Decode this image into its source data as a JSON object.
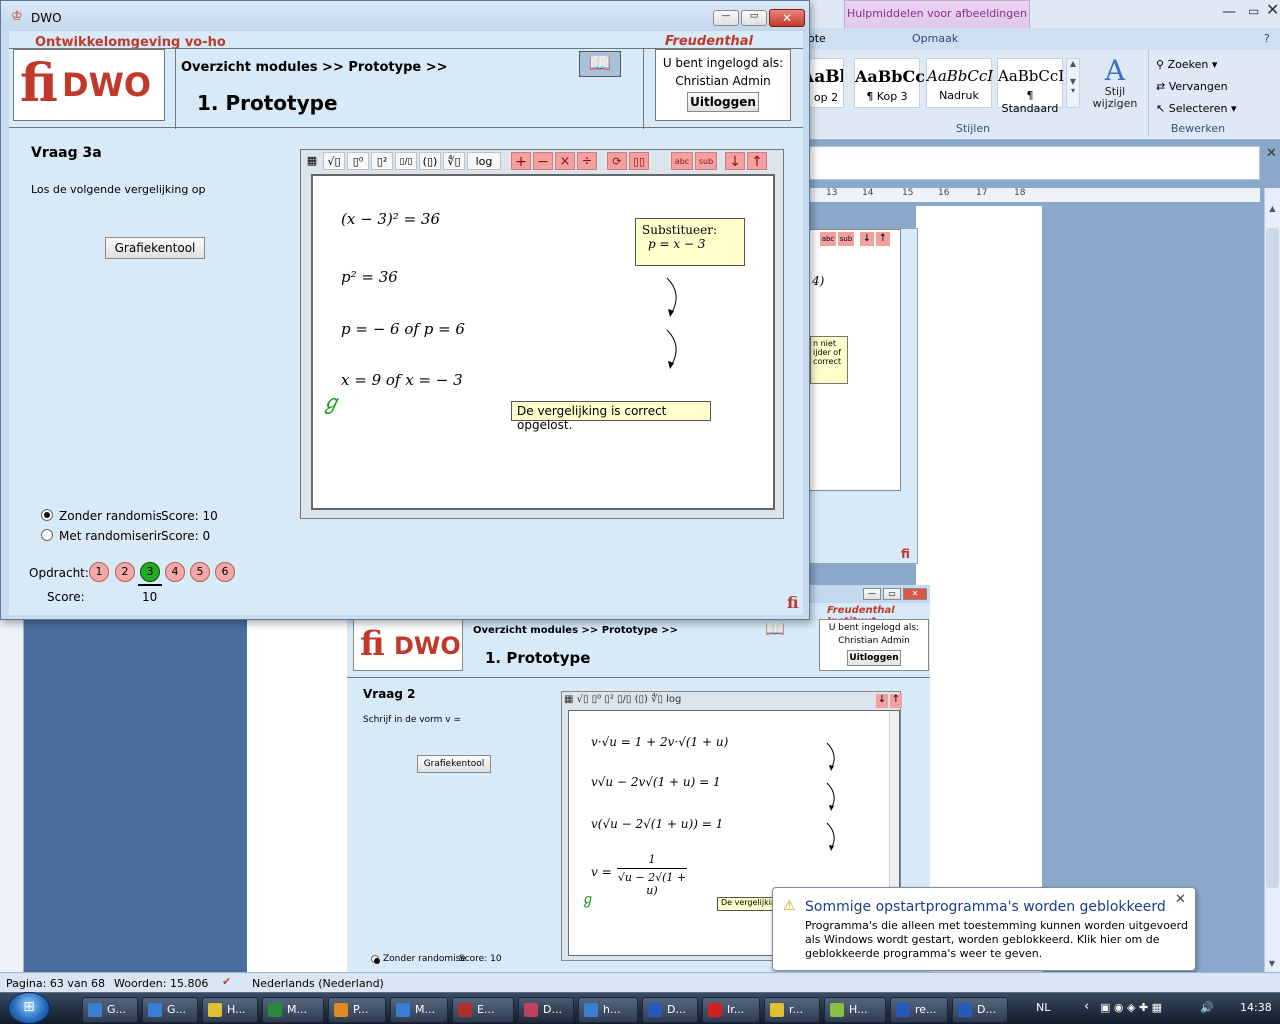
{
  "word": {
    "context_tab": "Hulpmiddelen voor afbeeldingen",
    "tab_cut": "ote",
    "tab_opmaak": "Opmaak",
    "styles": [
      {
        "sample": "AaBbC",
        "name": "op 2"
      },
      {
        "sample": "AaBbCc",
        "name": "¶ Kop 3"
      },
      {
        "sample": "AaBbCcI",
        "name": "Nadruk"
      },
      {
        "sample": "AaBbCcI",
        "name": "¶ Standaard"
      }
    ],
    "change_style": "Stijl wijzigen",
    "group_styles": "Stijlen",
    "find": "Zoeken",
    "replace": "Vervangen",
    "select": "Selecteren",
    "group_edit": "Bewerken",
    "ruler": [
      "13",
      "14",
      "15",
      "16",
      "17",
      "18"
    ],
    "status": {
      "page": "Pagina: 63 van 68",
      "words": "Woorden: 15.806",
      "language": "Nederlands (Nederland)"
    }
  },
  "dwo": {
    "title": "DWO",
    "env": "Ontwikkelomgeving vo-ho",
    "institute": "Freudenthal Instituut",
    "logo": "DWO",
    "breadcrumb": "Overzicht modules >> Prototype >>",
    "module_title": "1.  Prototype",
    "logged_in_label": "U bent ingelogd als:",
    "user": "Christian Admin",
    "logout": "Uitloggen",
    "question": "Vraag 3a",
    "instruction": "Los de volgende vergelijking op",
    "graph_tool": "Grafiekentool",
    "toolbar": {
      "log": "log",
      "abc": "abc",
      "sub": "sub"
    },
    "equations": [
      "(x − 3)² = 36",
      "p² = 36",
      "p = − 6  of p = 6",
      "x = 9  of x = − 3"
    ],
    "hint_label": "Substitueer:",
    "hint_formula": "p =  x − 3",
    "feedback": "De vergelijking is correct opgelost.",
    "option_no_random": "Zonder randomise",
    "option_random": "Met randomiserin",
    "score_a": "Score: 10",
    "score_b": "Score: 0",
    "assignment_label": "Opdracht:",
    "assignments": [
      "1",
      "2",
      "3",
      "4",
      "5",
      "6"
    ],
    "current_assignment": 3,
    "score_label": "Score:",
    "score_value": "10"
  },
  "dwo2": {
    "institute": "Freudenthal Instituut",
    "breadcrumb": "Overzicht modules >> Prototype >>",
    "module_title": "1.  Prototype",
    "logged_in_label": "U bent ingelogd als:",
    "user": "Christian Admin",
    "logout": "Uitloggen",
    "question": "Vraag 2",
    "instruction": "Schrijf in de vorm v =",
    "graph_tool": "Grafiekentool",
    "equations": [
      "v·√u = 1 + 2v·√(1 + u)",
      "v√u − 2v√(1 + u) = 1",
      "v(√u − 2√(1 + u)) = 1",
      "v ="
    ],
    "fraction_num": "1",
    "fraction_den": "√u − 2√(1 + u)",
    "feedback_cut": "De vergelijkin",
    "option_no_random": "Zonder randomise",
    "score_a": "Score: 10"
  },
  "dwo_behind": {
    "hint_lines": [
      "n niet",
      "ijder of",
      "correct"
    ],
    "eq_cut": "4)"
  },
  "balloon": {
    "title": "Sommige opstartprogramma's worden geblokkeerd",
    "body": "Programma's die alleen met toestemming kunnen worden uitgevoerd als Windows wordt gestart, worden geblokkeerd. Klik hier om de geblokkeerde programma's weer te geven."
  },
  "taskbar": {
    "items": [
      "G...",
      "G...",
      "H...",
      "M...",
      "P...",
      "M...",
      "E...",
      "D...",
      "h...",
      "D...",
      "Ir...",
      "r...",
      "H...",
      "re...",
      "D..."
    ],
    "language": "NL",
    "clock": "14:38"
  },
  "colors": {
    "accent_red": "#c0392b",
    "dwo_bg": "#d8eaf8",
    "hint_bg": "#ffffcc"
  }
}
